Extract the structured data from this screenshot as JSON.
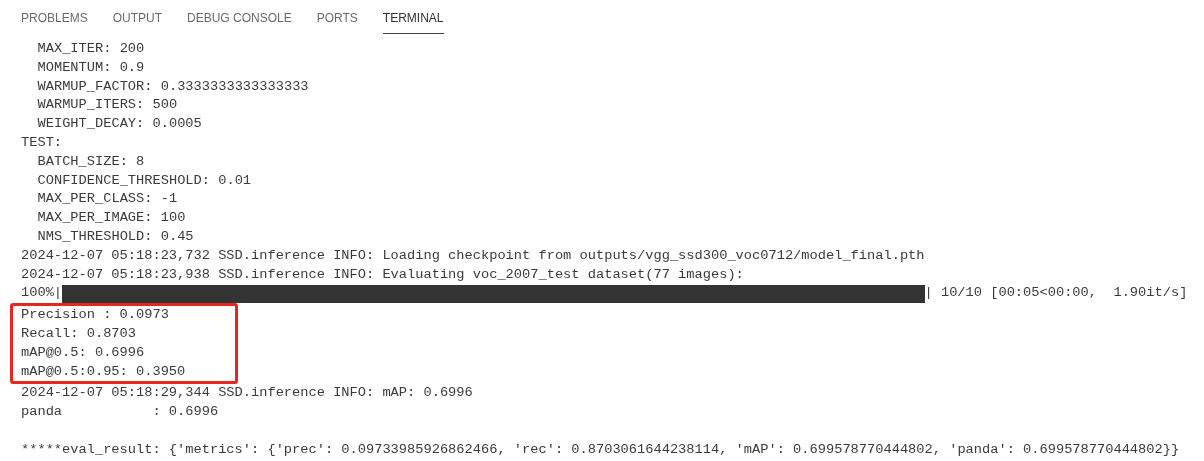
{
  "tabs": [
    {
      "label": "PROBLEMS",
      "selected": false
    },
    {
      "label": "OUTPUT",
      "selected": false
    },
    {
      "label": "DEBUG CONSOLE",
      "selected": false
    },
    {
      "label": "PORTS",
      "selected": false
    },
    {
      "label": "TERMINAL",
      "selected": true
    }
  ],
  "terminal": {
    "lines": [
      {
        "kind": "continued",
        "children": [
          {
            "kind": "text",
            "text": "MAX_ITER: 200"
          },
          {
            "kind": "text",
            "text": "MOMENTUM: 0.9"
          },
          {
            "kind": "text",
            "text": "WARMUP_FACTOR: 0.3333333333333333"
          },
          {
            "kind": "text",
            "text": "WARMUP_ITERS: 500"
          },
          {
            "kind": "text",
            "text": "WEIGHT_DECAY: 0.0005"
          }
        ]
      },
      {
        "kind": "text",
        "text": "TEST:",
        "children": [
          {
            "kind": "text",
            "text": "BATCH_SIZE: 8"
          },
          {
            "kind": "text",
            "text": "CONFIDENCE_THRESHOLD: 0.01"
          },
          {
            "kind": "text",
            "text": "MAX_PER_CLASS: -1"
          },
          {
            "kind": "text",
            "text": "MAX_PER_IMAGE: 100"
          },
          {
            "kind": "text",
            "text": "NMS_THRESHOLD: 0.45"
          }
        ]
      },
      {
        "kind": "text",
        "text": "2024-12-07 05:18:23,732 SSD.inference INFO: Loading checkpoint from outputs/vgg_ssd300_voc0712/model_final.pth"
      },
      {
        "kind": "text",
        "text": "2024-12-07 05:18:23,938 SSD.inference INFO: Evaluating voc_2007_test dataset(77 images):"
      },
      {
        "kind": "progress",
        "percent": "100%|",
        "level": 1,
        "status": "| 10/10 [00:05<00:00,  1.90it/s]"
      },
      {
        "kind": "highlight",
        "children": [
          {
            "kind": "text",
            "text": "Precision : 0.0973"
          },
          {
            "kind": "text",
            "text": "Recall: 0.8703"
          },
          {
            "kind": "text",
            "text": "mAP@0.5: 0.6996"
          },
          {
            "kind": "text",
            "text": "mAP@0.5:0.95: 0.3950"
          }
        ]
      },
      {
        "kind": "text",
        "text": "2024-12-07 05:18:29,344 SSD.inference INFO: mAP: 0.6996"
      },
      {
        "kind": "text",
        "text": "panda           : 0.6996"
      },
      {
        "kind": "blank"
      },
      {
        "kind": "text",
        "text": "*****eval_result: {'metrics': {'prec': 0.09733985926862466, 'rec': 0.8703061644238114, 'mAP': 0.699578770444802, 'panda': 0.699578770444802}}"
      }
    ]
  }
}
